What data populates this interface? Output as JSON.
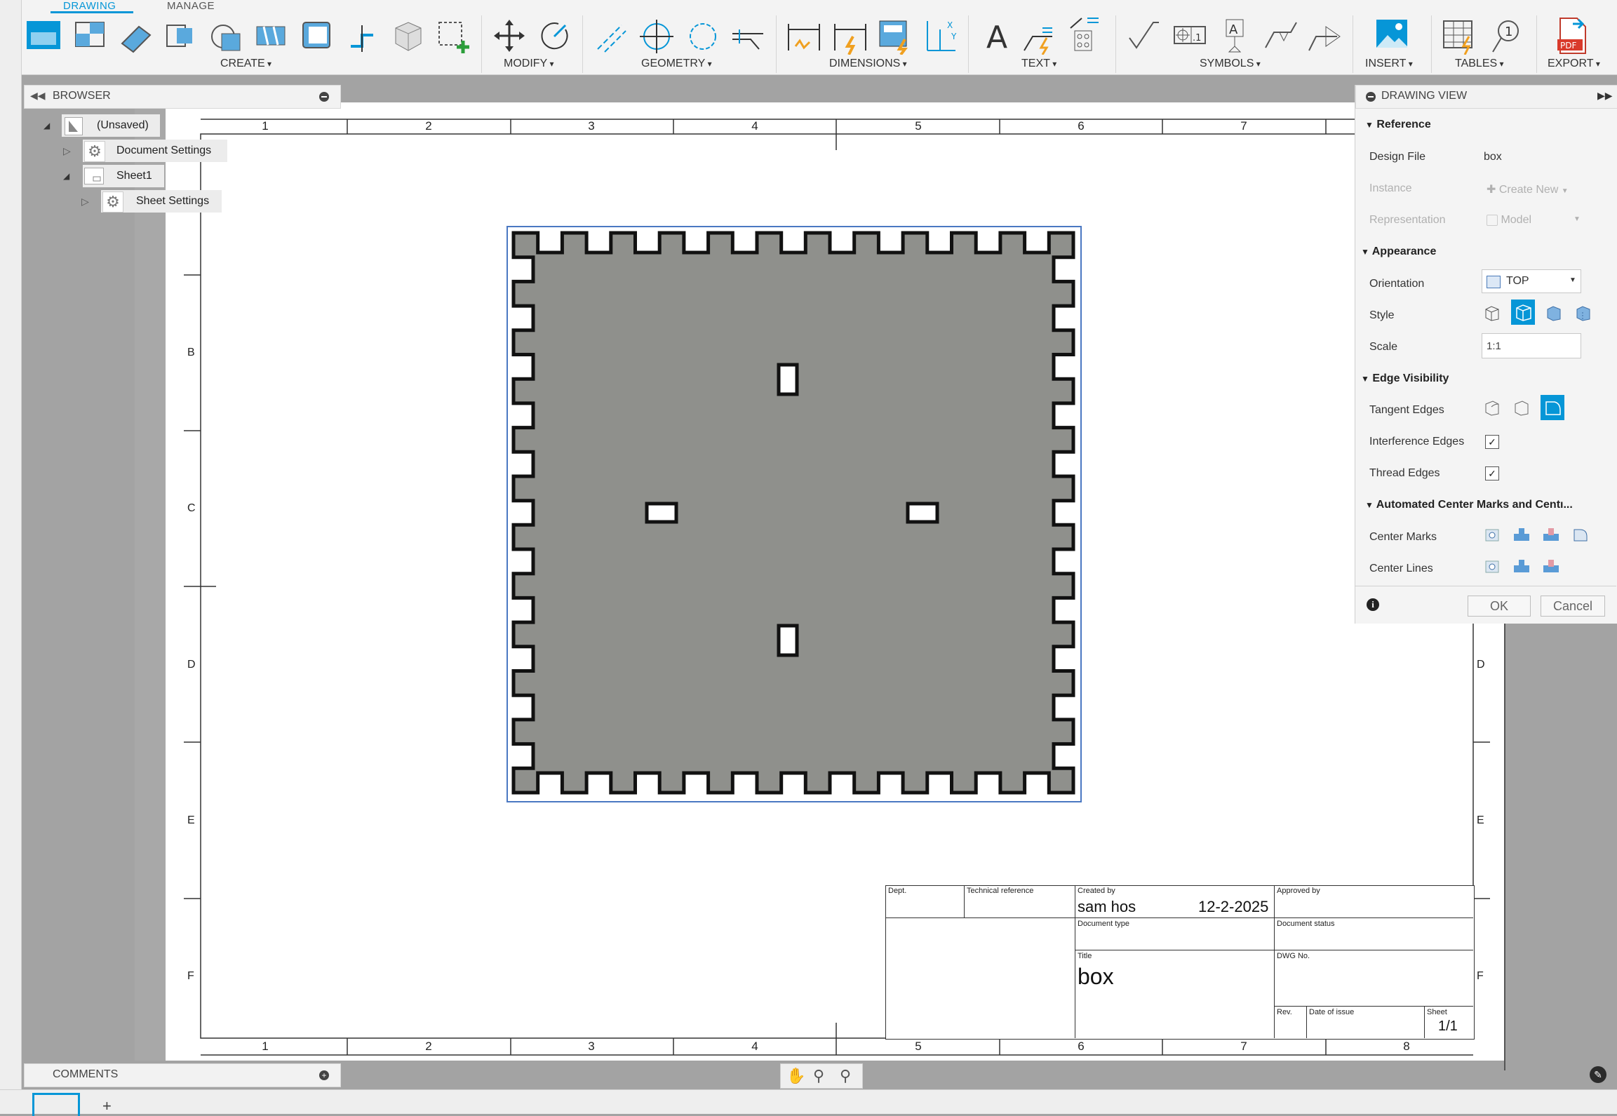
{
  "ribbon": {
    "tabs": {
      "drawing": "DRAWING",
      "manage": "MANAGE"
    },
    "groups": {
      "create": "CREATE",
      "modify": "MODIFY",
      "geometry": "GEOMETRY",
      "dimensions": "DIMENSIONS",
      "text": "TEXT",
      "symbols": "SYMBOLS",
      "insert": "INSERT",
      "tables": "TABLES",
      "export": "EXPORT"
    },
    "accent_color": "#0696d7"
  },
  "browser": {
    "title": "BROWSER",
    "items": [
      {
        "label": "(Unsaved)"
      },
      {
        "label": "Document Settings"
      },
      {
        "label": "Sheet1"
      },
      {
        "label": "Sheet Settings"
      }
    ]
  },
  "comments": {
    "title": "COMMENTS"
  },
  "sheet": {
    "columns_top": [
      "1",
      "2",
      "3",
      "4",
      "5",
      "6",
      "7"
    ],
    "columns_bottom": [
      "1",
      "2",
      "3",
      "4",
      "5",
      "6",
      "7",
      "8"
    ],
    "rows_left": [
      "B",
      "C",
      "D",
      "E",
      "F"
    ],
    "rows_right": [
      "D",
      "E",
      "F"
    ]
  },
  "title_block": {
    "dept_label": "Dept.",
    "tech_ref_label": "Technical reference",
    "created_by_label": "Created by",
    "created_by": "sam hos",
    "date": "12-2-2025",
    "approved_by_label": "Approved by",
    "doc_type_label": "Document type",
    "doc_status_label": "Document status",
    "title_label": "Title",
    "title": "box",
    "dwg_no_label": "DWG No.",
    "rev_label": "Rev.",
    "date_issue_label": "Date of issue",
    "sheet_label": "Sheet",
    "sheet_value": "1/1"
  },
  "drawing_view": {
    "title": "DRAWING VIEW",
    "sections": {
      "reference": "Reference",
      "appearance": "Appearance",
      "edge_visibility": "Edge Visibility",
      "center_marks": "Automated Center Marks and Centı..."
    },
    "design_file_label": "Design File",
    "design_file": "box",
    "instance_label": "Instance",
    "instance_value": "Create New",
    "representation_label": "Representation",
    "representation_value": "Model",
    "orientation_label": "Orientation",
    "orientation_value": "TOP",
    "style_label": "Style",
    "scale_label": "Scale",
    "scale_value": "1:1",
    "tangent_label": "Tangent Edges",
    "interference_label": "Interference Edges",
    "interference_checked": true,
    "thread_label": "Thread Edges",
    "thread_checked": true,
    "center_marks_label": "Center Marks",
    "center_lines_label": "Center Lines",
    "ok_label": "OK",
    "cancel_label": "Cancel"
  },
  "toolbar_icons": [
    "base-view-icon",
    "projected-view-icon",
    "section-view-icon",
    "detail-view-icon",
    "break-view-icon",
    "move-icon",
    "rotate-icon",
    "line-icon",
    "center-mark-icon",
    "circle-icon",
    "leader-icon",
    "dimension-icon",
    "auto-dimension-icon",
    "baseline-icon",
    "ordinate-icon",
    "text-icon",
    "leader-text-icon",
    "surface-texture-icon",
    "feature-control-icon",
    "datum-icon",
    "weld-icon",
    "image-icon",
    "table-icon",
    "balloon-icon",
    "pdf-icon"
  ]
}
